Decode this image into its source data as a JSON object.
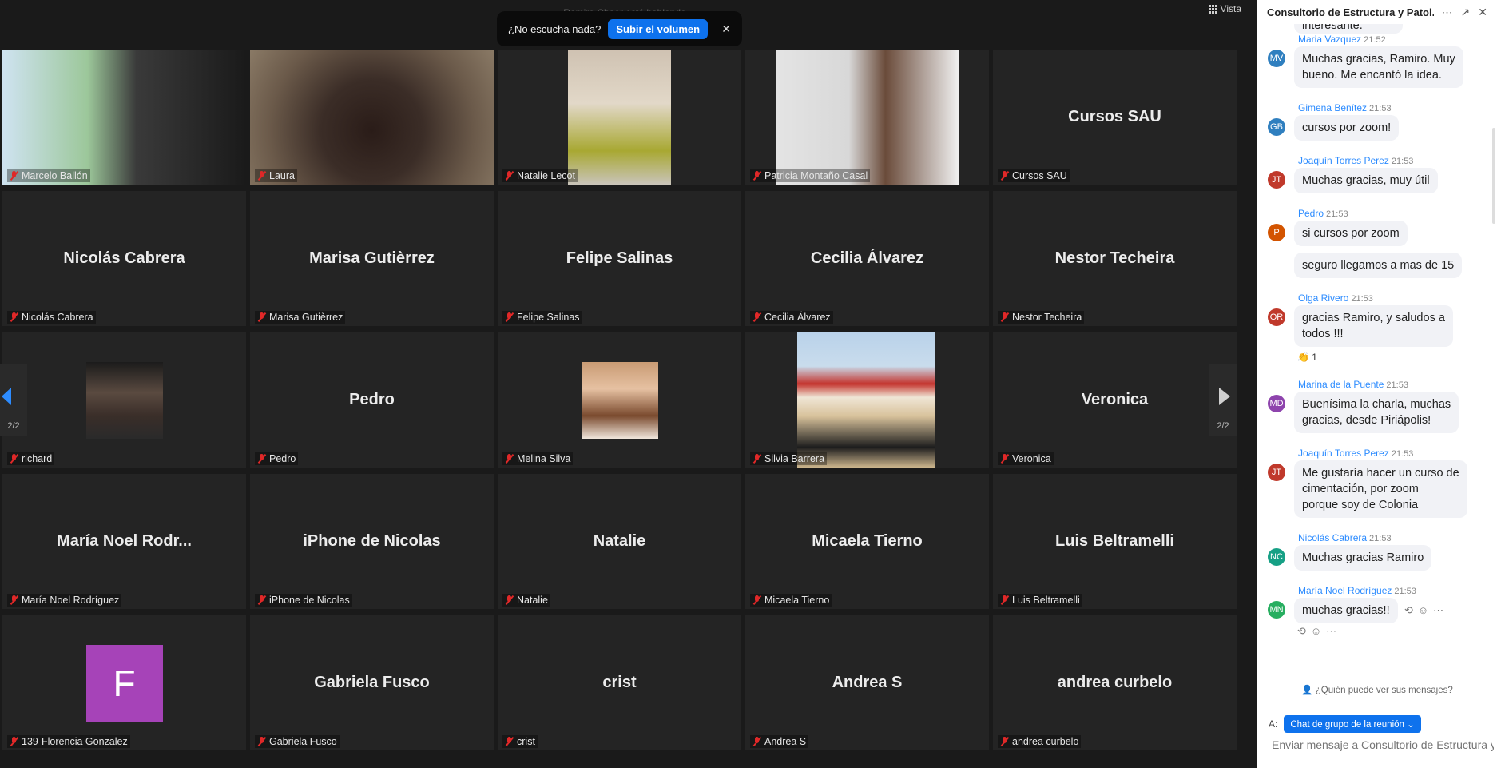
{
  "top_status": "Ramiro Chaer está hablando...",
  "view_button": "Vista",
  "audio_prompt": {
    "text": "¿No escucha nada?",
    "button": "Subir el volumen"
  },
  "participants": [
    {
      "display": "",
      "label": "Marcelo Ballón",
      "kind": "video"
    },
    {
      "display": "",
      "label": "Laura",
      "kind": "video"
    },
    {
      "display": "",
      "label": "Natalie Lecot",
      "kind": "video"
    },
    {
      "display": "",
      "label": "Patricia Montaño Casal",
      "kind": "video"
    },
    {
      "display": "Cursos SAU",
      "label": "Cursos SAU",
      "kind": "name"
    },
    {
      "display": "Nicolás Cabrera",
      "label": "Nicolás Cabrera",
      "kind": "name"
    },
    {
      "display": "Marisa Gutièrrez",
      "label": "Marisa Gutièrrez",
      "kind": "name"
    },
    {
      "display": "Felipe Salinas",
      "label": "Felipe Salinas",
      "kind": "name"
    },
    {
      "display": "Cecilia Álvarez",
      "label": "Cecilia Álvarez",
      "kind": "name"
    },
    {
      "display": "Nestor Techeira",
      "label": "Nestor Techeira",
      "kind": "name"
    },
    {
      "display": "",
      "label": "richard",
      "kind": "photo"
    },
    {
      "display": "Pedro",
      "label": "Pedro",
      "kind": "name"
    },
    {
      "display": "",
      "label": "Melina Silva",
      "kind": "photo"
    },
    {
      "display": "",
      "label": "Silvia Barrera",
      "kind": "photo"
    },
    {
      "display": "Veronica",
      "label": "Veronica",
      "kind": "name"
    },
    {
      "display": "María  Noel  Rodr...",
      "label": "María Noel Rodríguez",
      "kind": "name"
    },
    {
      "display": "iPhone de Nicolas",
      "label": "iPhone de Nicolas",
      "kind": "name"
    },
    {
      "display": "Natalie",
      "label": "Natalie",
      "kind": "name"
    },
    {
      "display": "Micaela Tierno",
      "label": "Micaela Tierno",
      "kind": "name"
    },
    {
      "display": "Luis Beltramelli",
      "label": "Luis Beltramelli",
      "kind": "name"
    },
    {
      "display": "F",
      "label": "139-Florencia Gonzalez",
      "kind": "letter"
    },
    {
      "display": "Gabriela Fusco",
      "label": "Gabriela Fusco",
      "kind": "name"
    },
    {
      "display": "crist",
      "label": "crist",
      "kind": "name"
    },
    {
      "display": "Andrea S",
      "label": "Andrea S",
      "kind": "name"
    },
    {
      "display": "andrea curbelo",
      "label": "andrea curbelo",
      "kind": "name"
    }
  ],
  "pagination": {
    "prev": "2/2",
    "next": "2/2"
  },
  "chat": {
    "title": "Consultorio de Estructura y Patol...",
    "top_fragment": "interesante.",
    "messages": [
      {
        "sender": "Maria Vazquez",
        "time": "21:52",
        "initials": "MV",
        "avatar_color": "#2f7fbf",
        "lines": [
          "Muchas gracias, Ramiro. Muy",
          "bueno. Me encantó la idea."
        ]
      },
      {
        "sender": "Gimena Benítez",
        "time": "21:53",
        "initials": "GB",
        "avatar_color": "#2f7fbf",
        "lines": [
          "cursos por zoom!"
        ]
      },
      {
        "sender": "Joaquín Torres Perez",
        "time": "21:53",
        "initials": "JT",
        "avatar_color": "#c0392b",
        "lines": [
          "Muchas gracias, muy útil"
        ]
      },
      {
        "sender": "Pedro",
        "time": "21:53",
        "initials": "P",
        "avatar_color": "#d35400",
        "lines": [
          "si cursos por zoom"
        ],
        "extra": "seguro llegamos a mas de 15"
      },
      {
        "sender": "Olga Rivero",
        "time": "21:53",
        "initials": "OR",
        "avatar_color": "#c0392b",
        "lines": [
          "gracias Ramiro, y saludos a",
          "todos !!!"
        ],
        "reaction": "👏 1"
      },
      {
        "sender": "Marina de la Puente",
        "time": "21:53",
        "initials": "MD",
        "avatar_color": "#8e44ad",
        "lines": [
          "Buenísima la charla, muchas",
          "gracias, desde Piriápolis!"
        ]
      },
      {
        "sender": "Joaquín Torres Perez",
        "time": "21:53",
        "initials": "JT",
        "avatar_color": "#c0392b",
        "lines": [
          "Me gustaría hacer un curso de",
          "cimentación, por zoom",
          "porque soy de Colonia"
        ]
      },
      {
        "sender": "Nicolás Cabrera",
        "time": "21:53",
        "initials": "NC",
        "avatar_color": "#16a085",
        "lines": [
          "Muchas gracias Ramiro"
        ]
      },
      {
        "sender": "María Noel Rodríguez",
        "time": "21:53",
        "initials": "MN",
        "avatar_color": "#27ae60",
        "lines": [
          "muchas gracias!!"
        ]
      }
    ],
    "privacy_note": "¿Quién puede ver sus mensajes?",
    "to_label": "A:",
    "recipient": "Chat de grupo de la reunión",
    "input_placeholder": "Enviar mensaje a Consultorio de Estructura y Patología"
  }
}
